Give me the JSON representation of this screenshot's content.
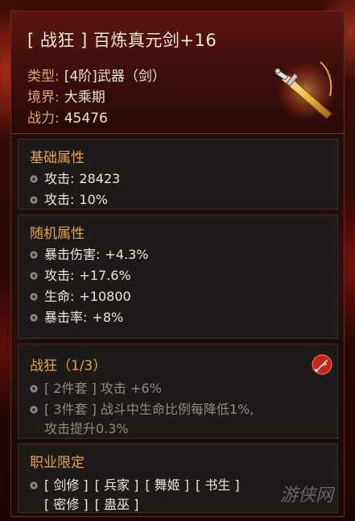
{
  "item": {
    "title": "[ 战狂 ] 百炼真元剑+16",
    "type_label": "类型:",
    "type_value": "[4阶]武器（剑）",
    "realm_label": "境界:",
    "realm_value": "大乘期",
    "power_label": "战力:",
    "power_value": "45476",
    "icon": "golden-sword-icon"
  },
  "base_attributes": {
    "title": "基础属性",
    "stats": [
      {
        "label": "攻击:",
        "value": "28423"
      },
      {
        "label": "攻击:",
        "value": "10%"
      }
    ]
  },
  "random_attributes": {
    "title": "随机属性",
    "stats": [
      {
        "label": "暴击伤害:",
        "value": "+4.3%"
      },
      {
        "label": "攻击:",
        "value": "+17.6%"
      },
      {
        "label": "生命:",
        "value": "+10800"
      },
      {
        "label": "暴击率:",
        "value": "+8%"
      }
    ]
  },
  "set_bonus": {
    "title": "战狂（1/3）",
    "icon": "sword-shield-badge-icon",
    "items": [
      {
        "line1": "[ 2件套 ] 攻击 +6%"
      },
      {
        "line1": "[ 3件套 ] 战斗中生命比例每降低1%,",
        "line2": "攻击提升0.3%"
      }
    ]
  },
  "class_restriction": {
    "title": "职业限定",
    "row1": [
      "[ 剑修 ]",
      "[ 兵家 ]",
      "[ 舞姬 ]",
      "[ 书生 ]"
    ],
    "row2": [
      "[ 密修 ]",
      "[ 蛊巫 ]"
    ]
  },
  "watermark": "游侠网",
  "colors": {
    "section_title": "#e2a445",
    "meta_label": "#d8a866",
    "text": "#ece7dc",
    "inactive_set": "#8f8a84"
  }
}
